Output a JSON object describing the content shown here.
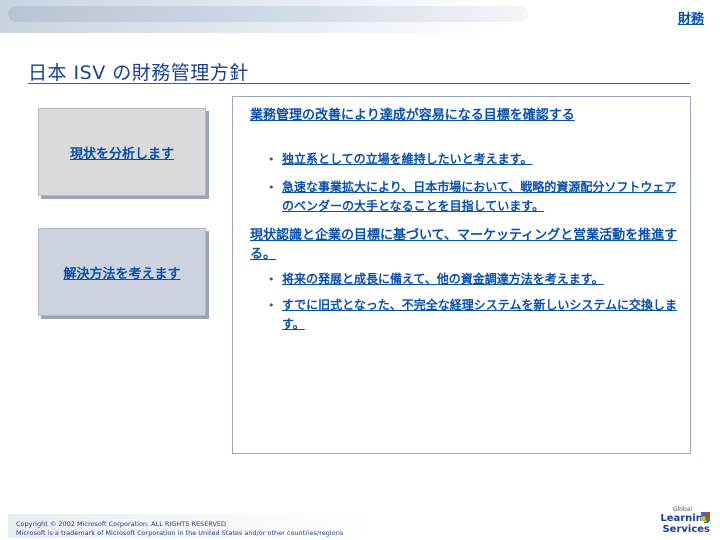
{
  "header": {
    "section_label": "財務"
  },
  "title": "日本 ISV の財務管理方針",
  "left_boxes": [
    {
      "label": "現状を分析します"
    },
    {
      "label": "解決方法を考えます"
    }
  ],
  "panel": {
    "heading1": "業務管理の改善により達成が容易になる目標を確認する",
    "bullets1": [
      "独立系としての立場を維持したいと考えます。",
      "急速な事業拡大により、日本市場において、戦略的資源配分ソフトウェアのベンダーの大手となることを目指しています。"
    ],
    "heading2": "現状認識と企業の目標に基づいて、マーケッティングと営業活動を推進する。",
    "bullets2": [
      "将来の発展と成長に備えて、他の資金調達方法を考えます。",
      "すでに旧式となった、不完全な経理システムを新しいシステムに交換します。"
    ]
  },
  "footer": {
    "line1": "Copyright © 2002 Microsoft Corporation. ALL RIGHTS RESERVED",
    "line2": "Microsoft is a trademark of Microsoft Corporation in the United States and/or other countries/regions"
  },
  "logo": {
    "line1": "Global",
    "line2": "Learning",
    "line3": "Services"
  }
}
